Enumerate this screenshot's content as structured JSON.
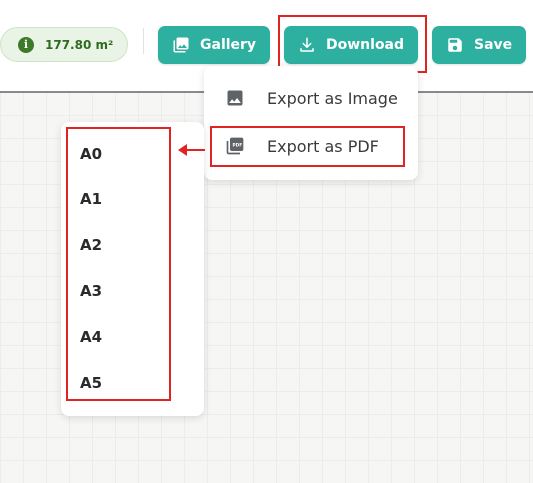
{
  "toolbar": {
    "area": "177.80 m²",
    "gallery_label": "Gallery",
    "download_label": "Download",
    "save_label": "Save"
  },
  "export_menu": {
    "items": [
      {
        "label": "Export as Image",
        "icon": "image-icon"
      },
      {
        "label": "Export as PDF",
        "icon": "pdf-icon"
      }
    ]
  },
  "paper_sizes": {
    "items": [
      "A0",
      "A1",
      "A2",
      "A3",
      "A4",
      "A5"
    ]
  },
  "colors": {
    "accent": "#2eb0a1",
    "highlight": "#e02424",
    "area_badge_text": "#2f6b20"
  }
}
